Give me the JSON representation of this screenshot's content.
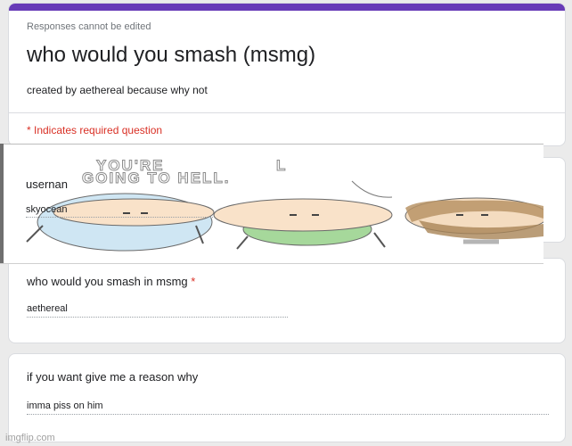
{
  "header": {
    "note": "Responses cannot be edited",
    "title": "who would you smash (msmg)",
    "description": "created by aethereal because why not",
    "required_note": "* Indicates required question",
    "accent_color": "#673ab7"
  },
  "questions": [
    {
      "label": "usernan",
      "answer": "skyocean"
    },
    {
      "label": "who would you smash in msmg",
      "required_mark": "*",
      "answer": "aethereal"
    },
    {
      "label": "if you want give me a reason why",
      "answer": "imma piss on him"
    }
  ],
  "overlay": {
    "comic_text_line1": "YOU'RE",
    "comic_text_line1b": "L",
    "comic_text_line2": "GOING TO HELL.",
    "characters": [
      "stick-figure-blue",
      "stick-figure-green",
      "stick-figure-bearded"
    ]
  },
  "watermark": "imgflip.com",
  "colors": {
    "required": "#d93025",
    "background": "#ebebeb"
  }
}
